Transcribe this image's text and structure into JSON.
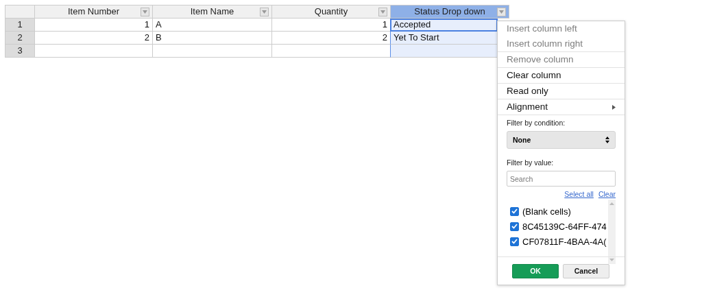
{
  "table": {
    "columns": [
      {
        "label": "Item Number",
        "selected": false
      },
      {
        "label": "Item Name",
        "selected": false
      },
      {
        "label": "Quantity",
        "selected": false
      },
      {
        "label": "Status Drop down",
        "selected": true
      }
    ],
    "rows": [
      {
        "header": "1",
        "cells": [
          "1",
          "A",
          "1",
          "Accepted"
        ]
      },
      {
        "header": "2",
        "cells": [
          "2",
          "B",
          "2",
          "Yet To Start"
        ]
      },
      {
        "header": "3",
        "cells": [
          "",
          "",
          "",
          ""
        ]
      }
    ]
  },
  "context_menu": {
    "items": [
      {
        "label": "Insert column left",
        "disabled": true,
        "submenu": false
      },
      {
        "label": "Insert column right",
        "disabled": true,
        "submenu": false
      },
      {
        "label": "Remove column",
        "disabled": true,
        "submenu": false
      },
      {
        "label": "Clear column",
        "disabled": false,
        "submenu": false
      },
      {
        "label": "Read only",
        "disabled": false,
        "submenu": false
      },
      {
        "label": "Alignment",
        "disabled": false,
        "submenu": true
      }
    ],
    "filter_by_condition": {
      "label": "Filter by condition:",
      "value": "None"
    },
    "filter_by_value": {
      "label": "Filter by value:",
      "placeholder": "Search",
      "select_all": "Select all",
      "clear": "Clear",
      "values": [
        {
          "label": "(Blank cells)",
          "checked": true
        },
        {
          "label": "8C45139C-64FF-474",
          "checked": true
        },
        {
          "label": "CF07811F-4BAA-4A(",
          "checked": true
        }
      ]
    },
    "buttons": [
      "OK",
      "Cancel"
    ]
  }
}
